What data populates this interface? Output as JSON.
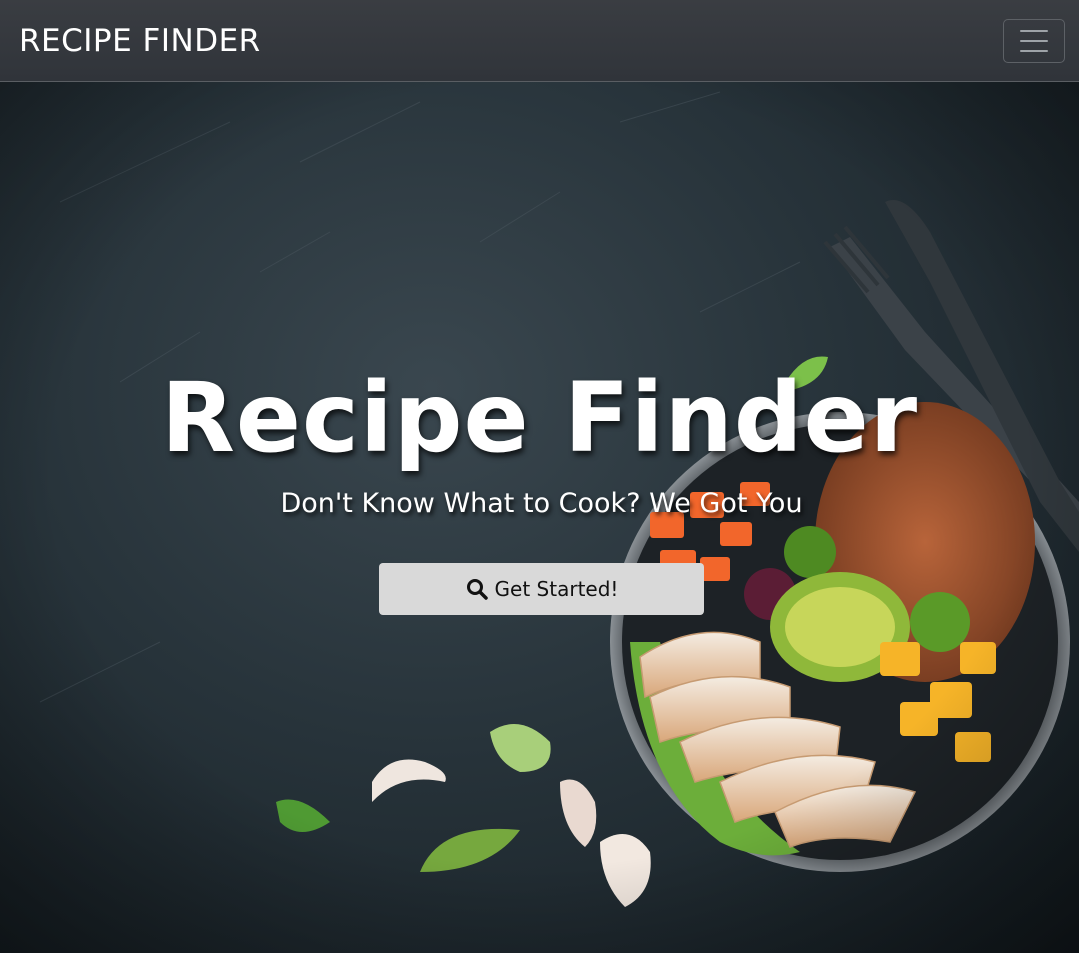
{
  "navbar": {
    "brand": "RECIPE FINDER",
    "toggler_icon": "hamburger-menu-icon"
  },
  "hero": {
    "title": "Recipe Finder",
    "subtitle": "Don't Know What to Cook? We Got You",
    "cta_label": "Get Started!",
    "cta_icon": "search-icon"
  },
  "colors": {
    "navbar_bg": "#34383d",
    "hero_bg": "#27333a",
    "button_bg": "#d9d9d9",
    "text": "#ffffff"
  }
}
